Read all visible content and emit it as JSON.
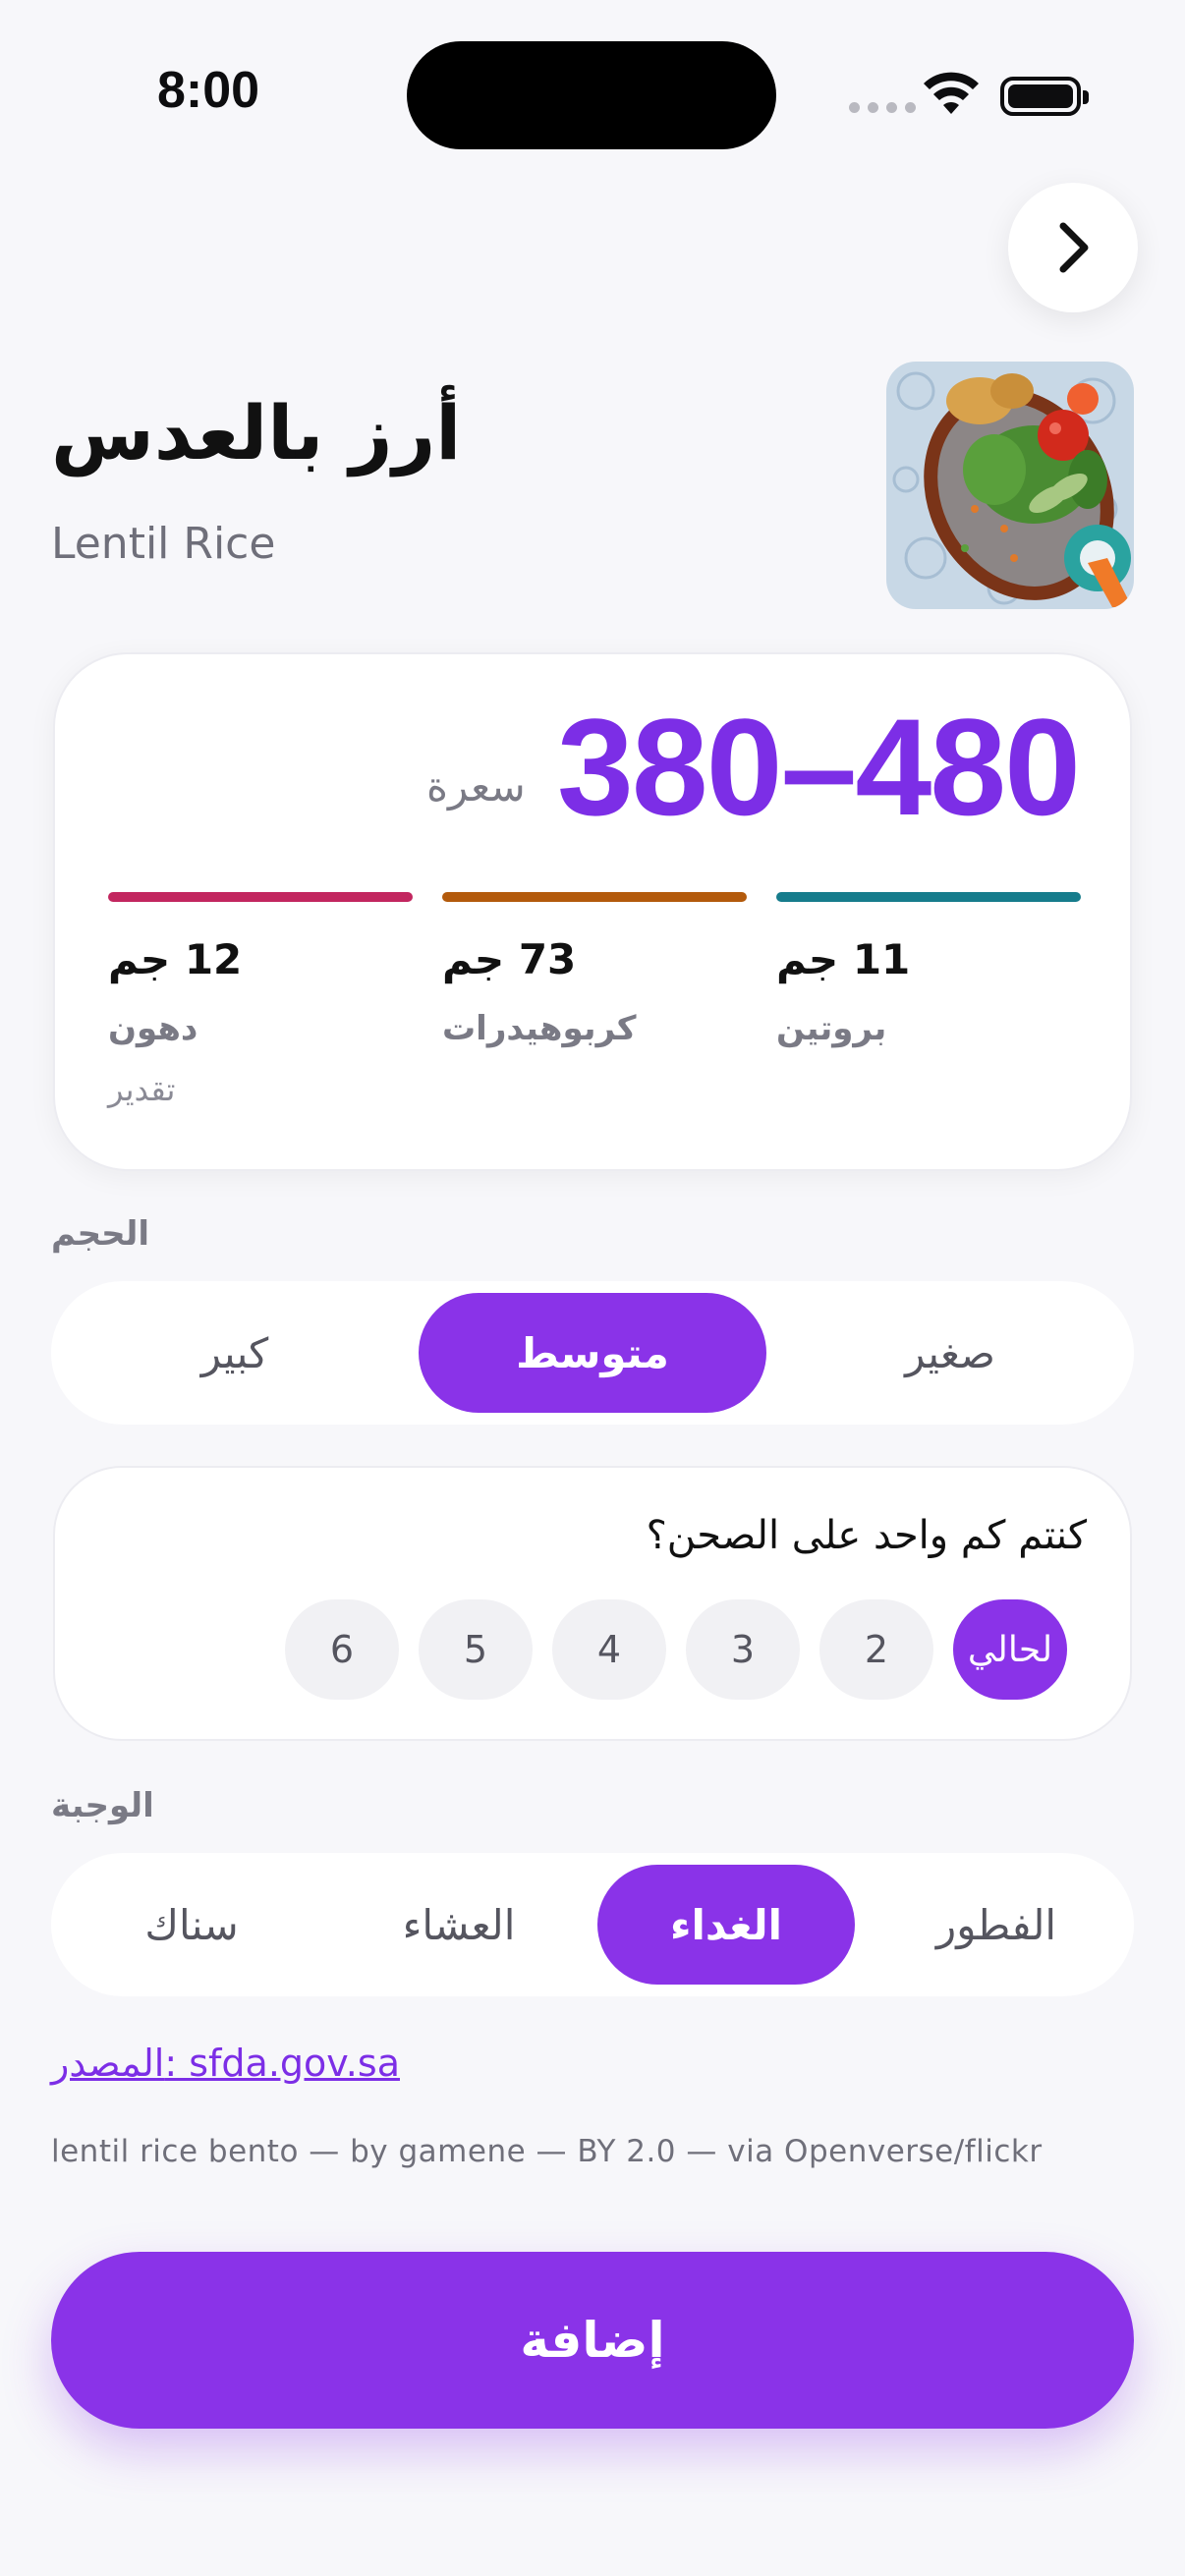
{
  "status_bar": {
    "time": "8:00"
  },
  "header": {
    "title_ar": "أرز بالعدس",
    "title_en": "Lentil Rice"
  },
  "nutrition": {
    "calories": "380–480",
    "calories_unit": "سعرة",
    "estimate_label": "تقدير",
    "macros": [
      {
        "label": "بروتين",
        "amount": "11 جم",
        "color": "#167c8c"
      },
      {
        "label": "كربوهيدرات",
        "amount": "73 جم",
        "color": "#b35a0c"
      },
      {
        "label": "دهون",
        "amount": "12 جم",
        "color": "#c2265f"
      }
    ]
  },
  "size": {
    "label": "الحجم",
    "options": [
      "صغير",
      "متوسط",
      "كبير"
    ],
    "selected": "متوسط"
  },
  "people": {
    "question": "كنتم كم واحد على الصحن؟",
    "options": [
      "لحالي",
      "2",
      "3",
      "4",
      "5",
      "6"
    ],
    "selected": "لحالي"
  },
  "meal": {
    "label": "الوجبة",
    "options": [
      "الفطور",
      "الغداء",
      "العشاء",
      "سناك"
    ],
    "selected": "الغداء"
  },
  "source": {
    "text": "المصدر: sfda.gov.sa"
  },
  "credit": "lentil rice bento — by gamene — BY 2.0 — via Openverse/flickr",
  "add_button": "إضافة",
  "colors": {
    "accent": "#8a33e8",
    "calorie_text": "#7c2ee6",
    "background": "#f7f7fa"
  },
  "icons": {
    "next": "chevron-right-icon",
    "wifi": "wifi-icon",
    "battery": "battery-icon"
  }
}
